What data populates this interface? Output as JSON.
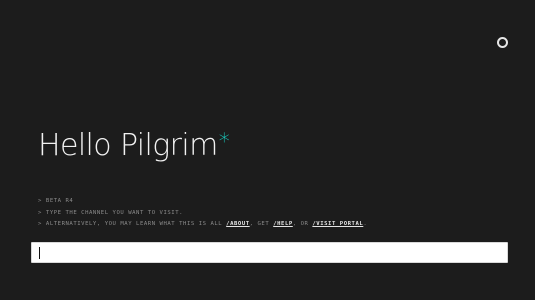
{
  "hero": {
    "title": "Hello Pilgrim",
    "mark": "*"
  },
  "notes": {
    "prompt": ">",
    "line1": "BETA R4",
    "line2": "TYPE THE CHANNEL YOU WANT TO VISIT.",
    "line3_prefix": "ALTERNATIVELY, YOU MAY LEARN WHAT THIS IS ALL",
    "link_about": "/ABOUT",
    "sep1": ", GET",
    "link_help": "/HELP",
    "sep2": ", OR",
    "link_visit_portal": "/VISIT PORTAL",
    "line3_end": "."
  },
  "command_input": {
    "value": ""
  },
  "colors": {
    "background": "#1c1c1c",
    "accent": "#19d3c5",
    "muted_text": "#8a8a8a"
  },
  "icons": {
    "status": "ring-icon"
  }
}
